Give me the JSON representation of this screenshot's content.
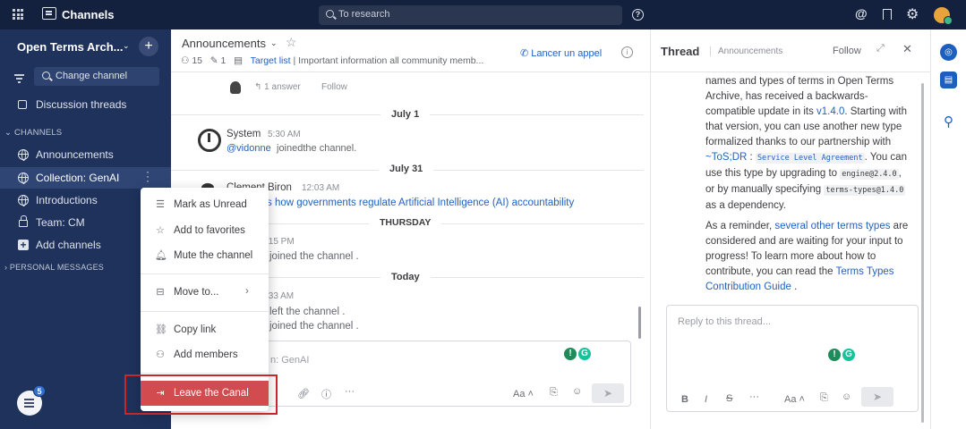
{
  "topbar": {
    "title": "Channels",
    "search_placeholder": "To research"
  },
  "sidebar": {
    "team_name": "Open Terms Arch...",
    "find_channel": "Change channel",
    "threads_label": "Discussion threads",
    "channels_section": "CHANNELS",
    "channels": [
      {
        "label": "Announcements",
        "icon": "globe-icon"
      },
      {
        "label": "Collection: GenAI",
        "icon": "globe-icon",
        "active": true
      },
      {
        "label": "Introductions",
        "icon": "globe-icon"
      },
      {
        "label": "Team: CM",
        "icon": "lock-icon"
      },
      {
        "label": "Add channels",
        "icon": "plus-square-icon"
      }
    ],
    "dm_section": "PERSONAL MESSAGES",
    "notif_badge": "5"
  },
  "channel": {
    "title": "Announcements",
    "members": "15",
    "pinned": "1",
    "target_link": "Target list",
    "purpose": "| Important information all community memb...",
    "call_label": "Lancer un appel"
  },
  "messages": {
    "reply_count": "1 answer",
    "follow_label": "Follow",
    "date1": "July 1",
    "sys_author": "System",
    "sys_time": "5:30 AM",
    "sys_mention": "@vidonne",
    "sys_text": "joinedthe channel.",
    "date2": "July 31",
    "author2": "Clement Biron",
    "time2": "12:03 AM",
    "link2": "s how governments regulate Artificial Intelligence (AI) accountability",
    "date3": "THURSDAY",
    "time3": ":15 PM",
    "text3": "joined the channel .",
    "date4": "Today",
    "time4": ":33 AM",
    "text4a": "left the channel .",
    "text4b": "joined the channel ."
  },
  "composer": {
    "placeholder": "n: GenAI",
    "aa_label": "Aa"
  },
  "context_menu": {
    "mark_unread": "Mark as Unread",
    "add_favorites": "Add to favorites",
    "mute": "Mute the channel",
    "move_to": "Move to...",
    "copy_link": "Copy link",
    "add_members": "Add members",
    "leave": "Leave the Canal"
  },
  "thread": {
    "title": "Thread",
    "subtitle": "Announcements",
    "follow_label": "Follow",
    "p1_a": "names and types of terms in Open Terms Archive, has received a backwards-compatible update in its",
    "p1_version": "v1.4.0",
    "p1_b": ". Starting with that version, you can use another new type formalized thanks to our partnership with",
    "p1_tosdr": "~ToS;DR",
    "p1_code1": "Service Level Agreement",
    "p1_c": ". You can use this type by upgrading to",
    "p1_code2": "engine@2.4.0",
    "p1_d": ", or by manually specifying",
    "p1_code3": "terms-types@1.4.0",
    "p1_e": "as a dependency.",
    "p2_a": "As a reminder,",
    "p2_link": "several other terms types",
    "p2_b": "are considered and are waiting for your input to progress! To learn more about how to contribute, you can read the",
    "p2_link2": "Terms Types Contribution Guide",
    "p2_c": ".",
    "reply_placeholder": "Reply to this thread...",
    "aa_label": "Aa"
  },
  "colors": {
    "topbar": "#14213e",
    "sidebar": "#1e325c",
    "link": "#2261c1",
    "danger": "#d24b4e"
  }
}
